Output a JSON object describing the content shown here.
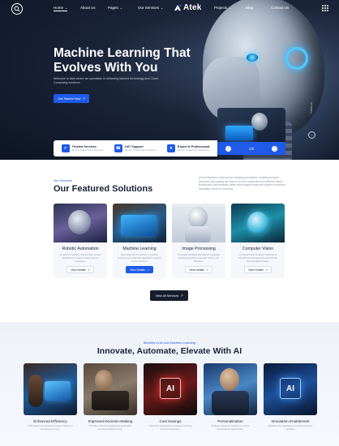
{
  "nav": {
    "links": [
      {
        "label": "Home",
        "has_menu": true
      },
      {
        "label": "About Us",
        "has_menu": false
      },
      {
        "label": "Pages",
        "has_menu": true
      },
      {
        "label": "Our Services",
        "has_menu": true
      },
      {
        "label": "Projects",
        "has_menu": true
      },
      {
        "label": "Blog",
        "has_menu": false
      },
      {
        "label": "Contact Us",
        "has_menu": false
      }
    ],
    "brand": "Atek",
    "chevron": "⌄"
  },
  "hero": {
    "title": "Machine Learning That Evolves With You",
    "description": "Welcome to Atek where we specialize in delivering tailored technology and Cloud Computing solutions.",
    "cta": "Get Started Now",
    "cta_arrow": "↗",
    "follow_label": "Follow Us",
    "slider": {
      "counter": "1/3",
      "prev": "‹",
      "next": "›"
    },
    "features": [
      {
        "title": "Trusted Services",
        "subtitle": "We Are Trusted Our Customers",
        "icon": "shield-icon",
        "glyph": "✔"
      },
      {
        "title": "24/7 Support",
        "subtitle": "We Are Trusted Our Customers",
        "icon": "support-icon",
        "glyph": "☎"
      },
      {
        "title": "Expert & Professional",
        "subtitle": "We Are Trusted Our Customers",
        "icon": "expert-icon",
        "glyph": "★"
      }
    ]
  },
  "services": {
    "eyebrow": "Our Services",
    "title": "Our Featured Solutions",
    "intro": "AI and Machine Learning are reshaping industries, enabling smarter solutions, and paving the way for a more connected and efficient future. Businesses that embrace these technologies today are poised to lead the innovation wave of tomorrow.",
    "cards": [
      {
        "title": "Robotic Automation",
        "text": "AI refers to systems that simulate human intelligence to perform tasks such as reasoning.",
        "button": "View Details",
        "primary": false
      },
      {
        "title": "Machine Learning",
        "text": "Deep learning is a subset of machine learning that deals with algorithms inspired by the structure.",
        "button": "View Details",
        "primary": true
      },
      {
        "title": "Image Processing",
        "text": "It includes subfields like Natural Language Processing (NLP), Computer Vision, and Robotics.",
        "button": "View Details",
        "primary": false
      },
      {
        "title": "Computer Vision",
        "text": "Computer vision enables machines to interpret & understand the visual world through digital images.",
        "button": "View Details",
        "primary": false
      }
    ],
    "view_all": "View All Services",
    "arrow": "↗"
  },
  "benefits": {
    "eyebrow": "Benefits of AI and Machine Learning",
    "title": "Innovate, Automate, Elevate With AI",
    "chip": "AI",
    "items": [
      {
        "title": "Enhanced Efficiency",
        "text": "Automates time-consuming tasks, freeing up resources for more."
      },
      {
        "title": "Improved Decision-Making",
        "text": "Provides real-time insights and actionable recommendations using."
      },
      {
        "title": "Cost Savings",
        "text": "Optimizes operational processes, reducing business expenses."
      },
      {
        "title": "Personalization",
        "text": "Analyzes customer behavior to create personalized experiences."
      },
      {
        "title": "Innovation Enablement",
        "text": "Facilitates the development of new products, services."
      }
    ]
  },
  "colors": {
    "accent": "#1f5be8",
    "hero_bg": "#0d1424",
    "dark_button": "#151c2c"
  }
}
